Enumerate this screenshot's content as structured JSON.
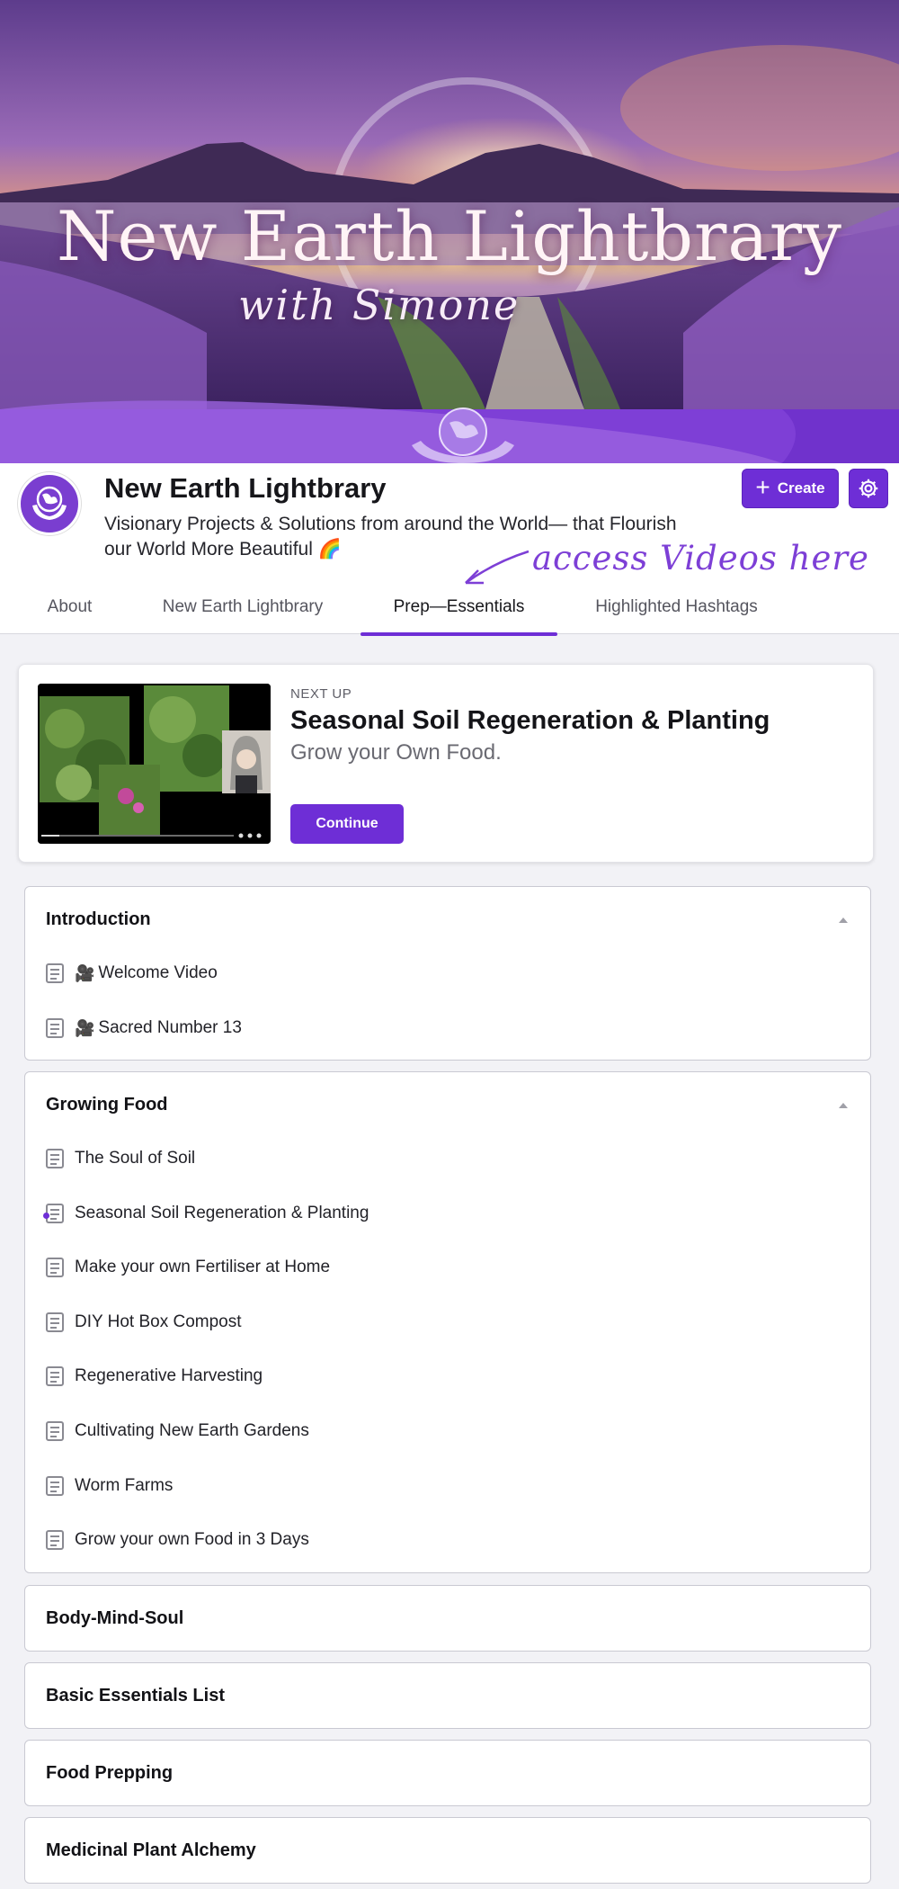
{
  "banner": {
    "title": "New Earth Lightbrary",
    "subtitle": "with Simone"
  },
  "group": {
    "name": "New Earth Lightbrary",
    "description": "Visionary Projects & Solutions from around the World— that Flourish our World More Beautiful 🌈",
    "create_label": "Create",
    "annotation": "access Videos here"
  },
  "tabs": [
    {
      "label": "About"
    },
    {
      "label": "New Earth Lightbrary"
    },
    {
      "label": "Prep—Essentials"
    },
    {
      "label": "Highlighted Hashtags"
    }
  ],
  "active_tab": "Prep—Essentials",
  "next_up": {
    "label": "NEXT UP",
    "title": "Seasonal Soil Regeneration & Planting",
    "subtitle": "Grow your Own Food.",
    "button": "Continue"
  },
  "sections": [
    {
      "title": "Introduction",
      "expanded": true,
      "lessons": [
        {
          "prefix": "🎥",
          "label": "Welcome Video"
        },
        {
          "prefix": "🎥",
          "label": "Sacred Number 13"
        }
      ]
    },
    {
      "title": "Growing Food",
      "expanded": true,
      "lessons": [
        {
          "label": "The Soul of Soil"
        },
        {
          "label": "Seasonal Soil Regeneration & Planting",
          "current": true
        },
        {
          "label": "Make your own Fertiliser at Home"
        },
        {
          "label": "DIY Hot Box Compost"
        },
        {
          "label": "Regenerative Harvesting"
        },
        {
          "label": "Cultivating New Earth Gardens"
        },
        {
          "label": "Worm Farms"
        },
        {
          "label": "Grow your own Food in 3 Days"
        }
      ]
    },
    {
      "title": "Body-Mind-Soul",
      "expanded": false
    },
    {
      "title": "Basic Essentials List",
      "expanded": false
    },
    {
      "title": "Food Prepping",
      "expanded": false
    },
    {
      "title": "Medicinal Plant Alchemy",
      "expanded": false
    }
  ],
  "colors": {
    "accent": "#6e2ed6",
    "page_bg": "#f2f2f6"
  }
}
